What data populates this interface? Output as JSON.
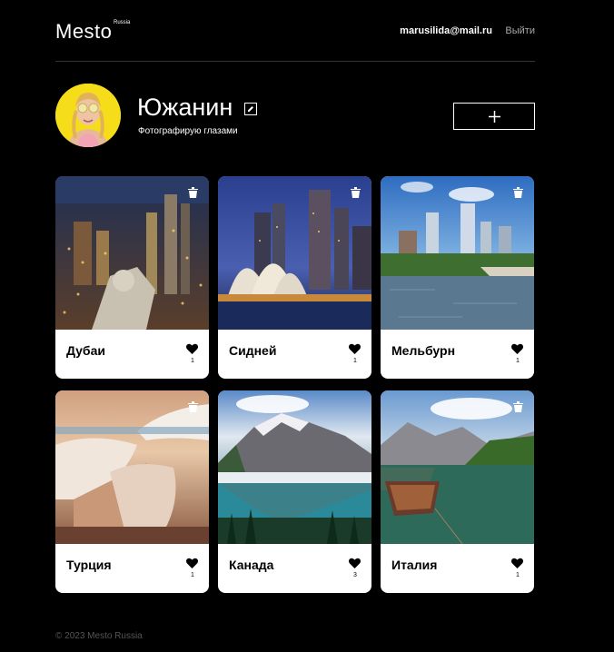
{
  "header": {
    "logo": "Mesto",
    "logo_sub": "Russia",
    "email": "marusilida@mail.ru",
    "logout": "Выйти"
  },
  "profile": {
    "name": "Южанин",
    "about": "Фотографирую глазами"
  },
  "cards": [
    {
      "title": "Дубаи",
      "likes": "1"
    },
    {
      "title": "Сидней",
      "likes": "1"
    },
    {
      "title": "Мельбурн",
      "likes": "1"
    },
    {
      "title": "Турция",
      "likes": "1"
    },
    {
      "title": "Канада",
      "likes": "3"
    },
    {
      "title": "Италия",
      "likes": "1"
    }
  ],
  "footer": {
    "copyright": "© 2023 Mesto Russia"
  },
  "icons": {
    "edit": "pencil-icon",
    "add": "plus-icon",
    "delete": "trash-icon",
    "like": "heart-icon"
  }
}
